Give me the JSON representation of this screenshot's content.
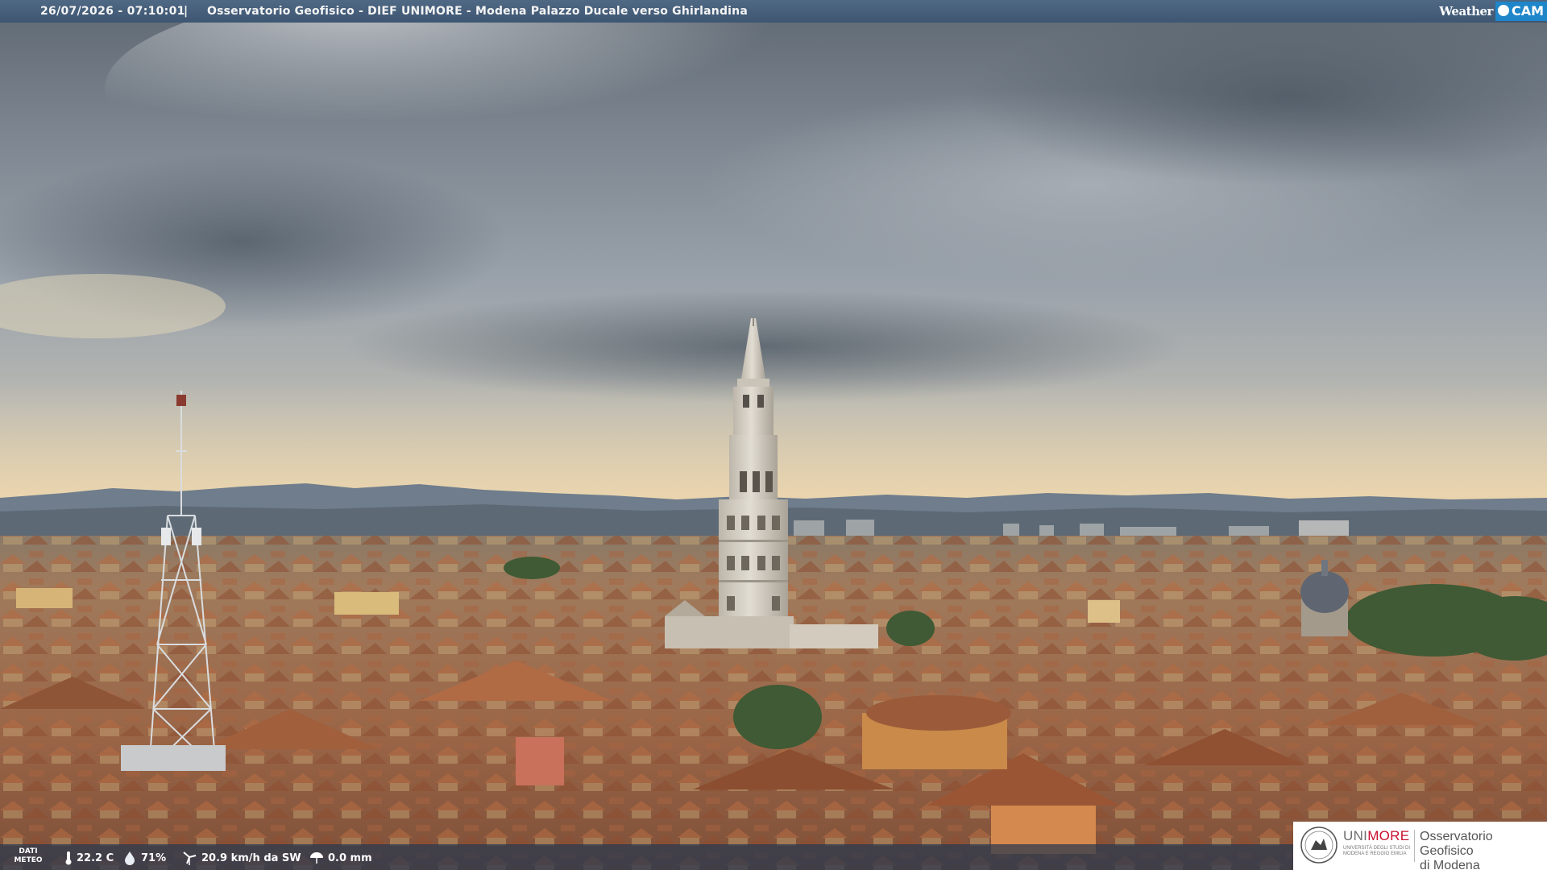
{
  "overlay": {
    "datetime": "26/07/2026 - 07:10:01",
    "separator": "|",
    "caption": "Osservatorio Geofisico - DIEF UNIMORE - Modena Palazzo Ducale verso Ghirlandina",
    "brand_left": "Weather",
    "brand_right": "CAM"
  },
  "meteo": {
    "tag_line1": "DATI",
    "tag_line2": "METEO",
    "temperature": "22.2 C",
    "humidity": "71%",
    "wind": "20.9 km/h da SW",
    "rain": "0.0 mm",
    "icons": [
      "thermometer-icon",
      "humidity-drop-icon",
      "wind-turbine-icon",
      "rain-umbrella-icon"
    ]
  },
  "logo": {
    "brand_prefix": "UNI",
    "brand_suffix": "MORE",
    "brand_sub": "UNIVERSITÀ DEGLI STUDI DI MODENA E REGGIO EMILIA",
    "obs_line1": "Osservatorio Geofisico",
    "obs_line2": "di Modena",
    "accent": "#c8102e"
  },
  "colors": {
    "topbar": "#465f7c",
    "weathercam_blue": "#1f86c9",
    "sky_cloud": "#8b939c",
    "roof_terracotta": "#b06b45",
    "tower_stone": "#d8d2c8"
  }
}
